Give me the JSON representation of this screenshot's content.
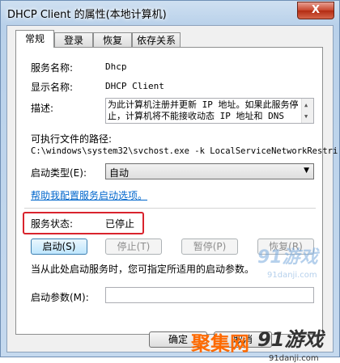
{
  "window": {
    "title": "DHCP Client 的属性(本地计算机)",
    "close_glyph": "X"
  },
  "tabs": [
    "常规",
    "登录",
    "恢复",
    "依存关系"
  ],
  "general": {
    "service_name_label": "服务名称:",
    "service_name_value": "Dhcp",
    "display_name_label": "显示名称:",
    "display_name_value": "DHCP Client",
    "description_label": "描述:",
    "description_value": "为此计算机注册并更新 IP 地址。如果此服务停止，计算机将不能接收动态 IP 地址和 DNS",
    "exe_path_label": "可执行文件的路径:",
    "exe_path_value": "C:\\windows\\system32\\svchost.exe -k LocalServiceNetworkRestri",
    "startup_type_label": "启动类型(E):",
    "startup_type_value": "自动",
    "help_link": "帮助我配置服务启动选项。",
    "status_label": "服务状态:",
    "status_value": "已停止",
    "buttons": {
      "start": "启动(S)",
      "stop": "停止(T)",
      "pause": "暂停(P)",
      "resume": "恢复(R)"
    },
    "hint": "当从此处启动服务时，您可指定所适用的启动参数。",
    "start_params_label": "启动参数(M):",
    "start_params_value": ""
  },
  "footer": {
    "ok": "确定",
    "cancel": "取消"
  },
  "watermarks": {
    "site1": "91游戏",
    "site1_url": "91danji.com",
    "site2": "聚集网",
    "site3": "91游戏",
    "site3_url": "91danji.com"
  },
  "colors": {
    "highlight_border": "#d9232d",
    "link": "#0066cc"
  }
}
